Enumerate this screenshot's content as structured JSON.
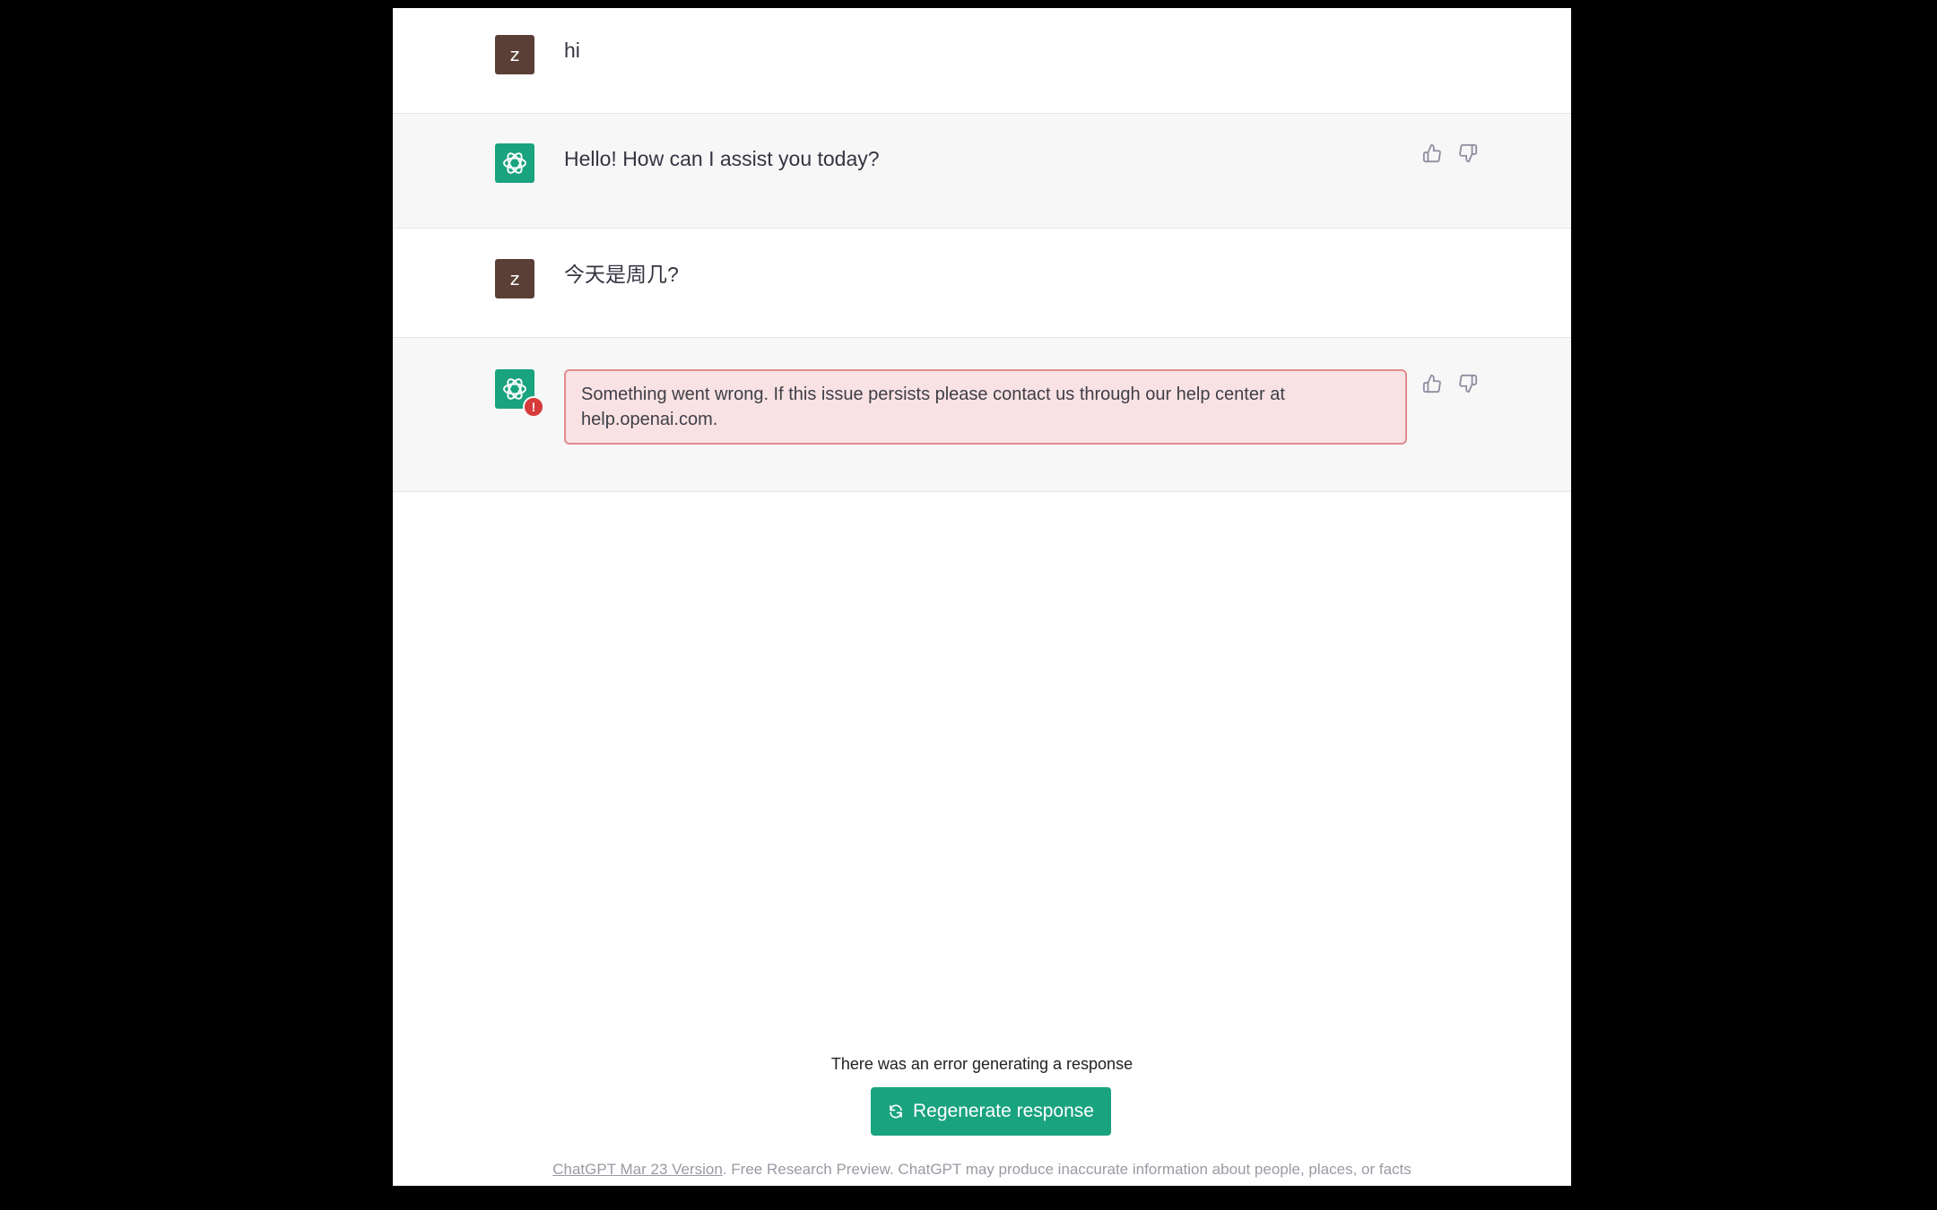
{
  "conversation": {
    "user_initial": "z",
    "messages": [
      {
        "role": "user",
        "text": "hi"
      },
      {
        "role": "assistant",
        "text": "Hello! How can I assist you today?"
      },
      {
        "role": "user",
        "text": "今天是周几?"
      },
      {
        "role": "assistant",
        "error": true,
        "text": "Something went wrong. If this issue persists please contact us through our help center at help.openai.com."
      }
    ],
    "error_badge": "!"
  },
  "bottom": {
    "status_text": "There was an error generating a response",
    "regenerate_label": "Regenerate response",
    "regenerate_icon": "refresh-icon"
  },
  "footer": {
    "version_link": "ChatGPT Mar 23 Version",
    "disclaimer": ". Free Research Preview. ChatGPT may produce inaccurate information about people, places, or facts"
  },
  "colors": {
    "brand_green": "#19a37f",
    "user_avatar": "#5a3f36",
    "error_bg": "#f9e2e3",
    "error_border": "#e08b8f"
  }
}
